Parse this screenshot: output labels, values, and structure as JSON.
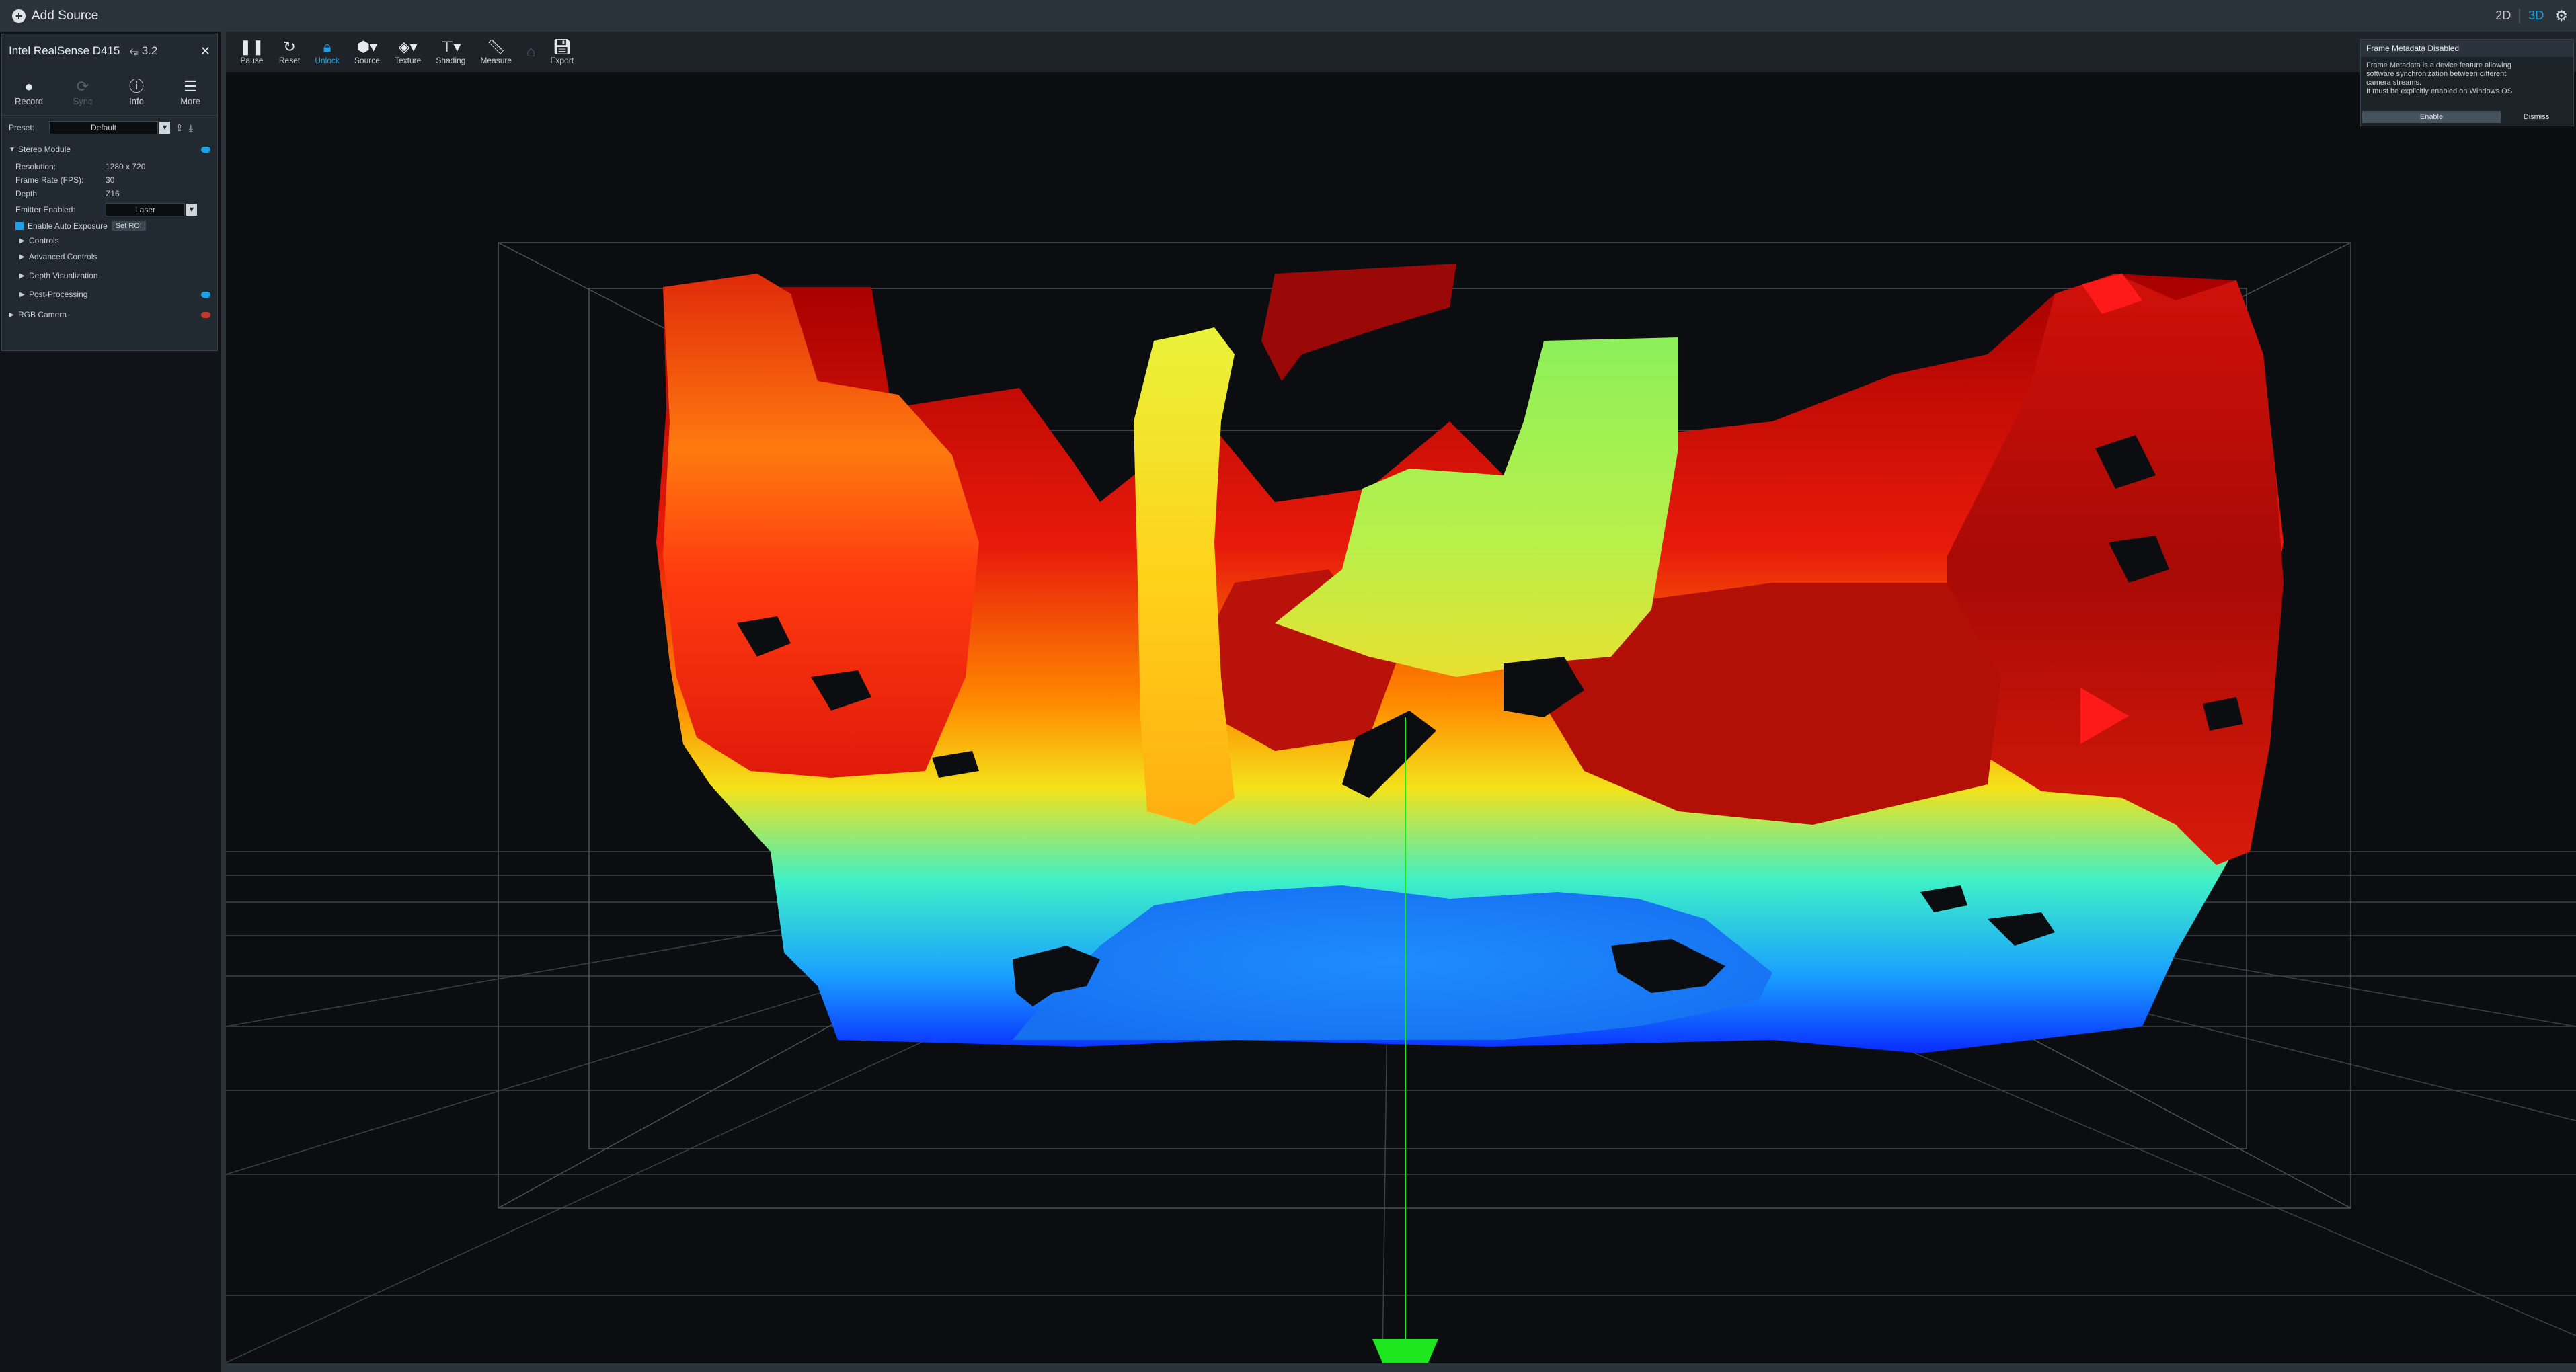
{
  "topbar": {
    "add_source_label": "Add Source",
    "view_modes": [
      "2D",
      "3D"
    ],
    "active_view": "3D"
  },
  "device": {
    "name": "Intel RealSense D415",
    "usb_version": "3.2",
    "actions": [
      {
        "label": "Record",
        "icon": "record-icon",
        "enabled": true
      },
      {
        "label": "Sync",
        "icon": "sync-icon",
        "enabled": false
      },
      {
        "label": "Info",
        "icon": "info-icon",
        "enabled": true
      },
      {
        "label": "More",
        "icon": "menu-icon",
        "enabled": true
      }
    ],
    "preset_label": "Preset:",
    "preset_value": "Default",
    "stereo_module": {
      "title": "Stereo Module",
      "toggle_label": "on",
      "resolution_label": "Resolution:",
      "resolution": "1280 x 720",
      "fps_label": "Frame Rate (FPS):",
      "fps": "30",
      "stream_label": "Depth",
      "stream_format": "Z16",
      "emitter_label": "Emitter Enabled:",
      "emitter_value": "Laser",
      "auto_exposure_label": "Enable Auto Exposure",
      "set_roi_label": "Set ROI",
      "sub_items": [
        "Controls",
        "Advanced Controls",
        "Depth Visualization",
        "Post-Processing"
      ]
    },
    "rgb_camera": {
      "title": "RGB Camera",
      "toggle_label": "off"
    }
  },
  "toolbar": [
    {
      "label": "Pause",
      "icon": "pause-icon",
      "state": "normal"
    },
    {
      "label": "Reset",
      "icon": "reset-icon",
      "state": "normal"
    },
    {
      "label": "Unlock",
      "icon": "lock-icon",
      "state": "active"
    },
    {
      "label": "Source",
      "icon": "cube-icon",
      "state": "normal"
    },
    {
      "label": "Texture",
      "icon": "paint-bucket-icon",
      "state": "normal"
    },
    {
      "label": "Shading",
      "icon": "paint-roller-icon",
      "state": "normal"
    },
    {
      "label": "Measure",
      "icon": "ruler-icon",
      "state": "normal"
    },
    {
      "label": "Export",
      "icon": "save-icon",
      "state": "normal"
    }
  ],
  "notification": {
    "title": "Frame Metadata Disabled",
    "message": "Frame Metadata is a device feature allowing\nsoftware synchronization between different\ncamera streams.\nIt must be explicitly enabled on Windows OS",
    "enable_label": "Enable",
    "dismiss_label": "Dismiss"
  },
  "colors": {
    "accent": "#1ea1e6",
    "panel": "#222a31",
    "toolbar": "#1d2329",
    "viewport": "#0b0d10",
    "axis_green": "#1ee61e",
    "axis_red": "#ff1a1a"
  }
}
